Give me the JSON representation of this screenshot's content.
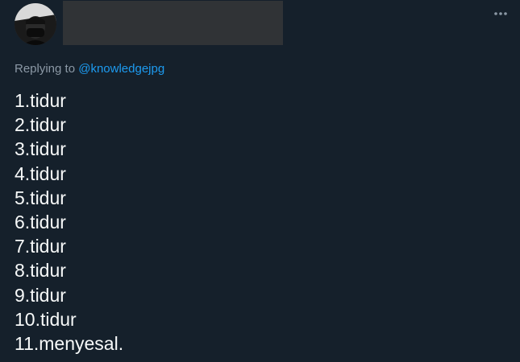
{
  "reply_context": {
    "prefix": "Replying to",
    "handle": "@knowledgejpg"
  },
  "tweet": {
    "lines": [
      "1.tidur",
      "2.tidur",
      "3.tidur",
      "4.tidur",
      "5.tidur",
      "6.tidur",
      "7.tidur",
      "8.tidur",
      "9.tidur",
      "10.tidur",
      "11.menyesal."
    ]
  },
  "icons": {
    "avatar": "avatar-photo",
    "more": "more-horizontal-icon"
  },
  "colors": {
    "background": "#15202b",
    "text": "#f7f9f9",
    "secondary_text": "#8b98a5",
    "link": "#1d9bf0",
    "redaction": "#303336"
  }
}
